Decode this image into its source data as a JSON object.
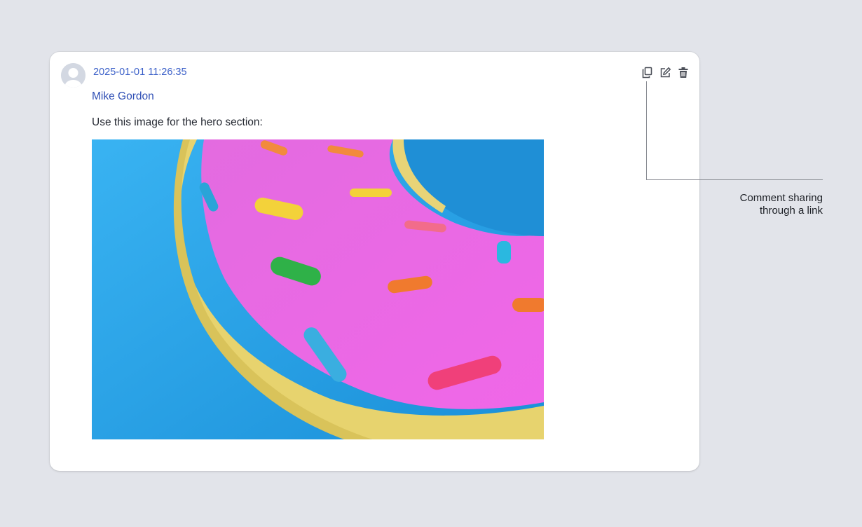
{
  "comment": {
    "timestamp": "2025-01-01 11:26:35",
    "author": "Mike Gordon",
    "message": "Use this image for the hero section:",
    "image_icon": "inflatable-donut-photo"
  },
  "actions": {
    "copy_icon": "copy-link-icon",
    "edit_icon": "edit-icon",
    "delete_icon": "trash-icon"
  },
  "callout": {
    "line1": "Comment sharing",
    "line2": "through a link"
  },
  "colors": {
    "background": "#e2e4ea",
    "link": "#2f4fb5",
    "icon": "#4b4f58"
  }
}
